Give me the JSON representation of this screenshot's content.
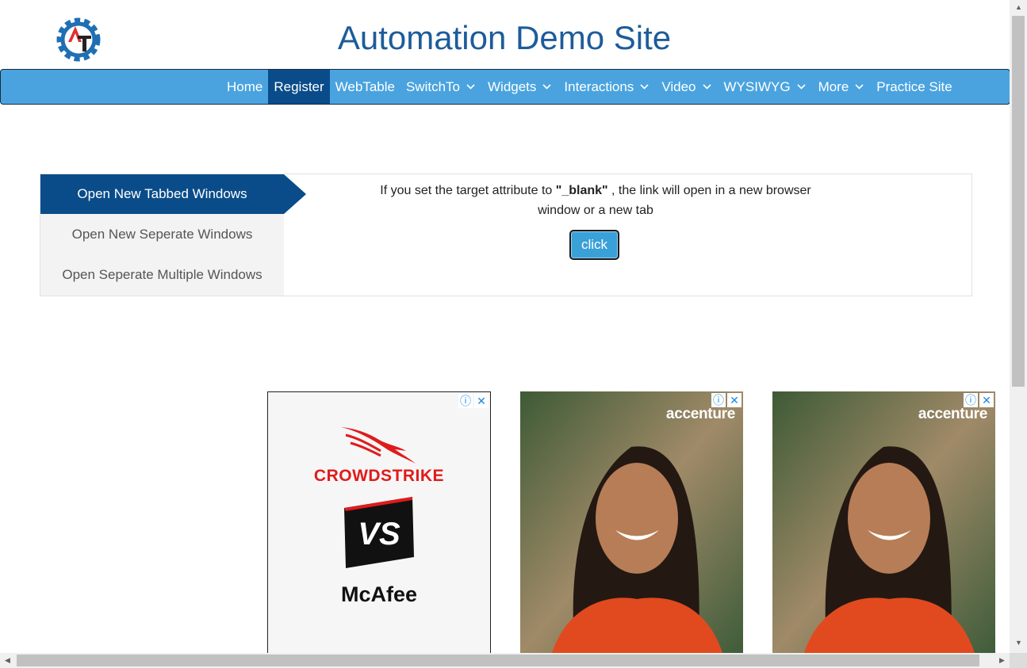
{
  "header": {
    "title": "Automation Demo Site",
    "logo_icon": "gear-logo-icon"
  },
  "nav": {
    "items": [
      {
        "label": "Home",
        "active": false,
        "dropdown": false
      },
      {
        "label": "Register",
        "active": true,
        "dropdown": false
      },
      {
        "label": "WebTable",
        "active": false,
        "dropdown": false
      },
      {
        "label": "SwitchTo",
        "active": false,
        "dropdown": true
      },
      {
        "label": "Widgets",
        "active": false,
        "dropdown": true
      },
      {
        "label": "Interactions",
        "active": false,
        "dropdown": true
      },
      {
        "label": "Video",
        "active": false,
        "dropdown": true
      },
      {
        "label": "WYSIWYG",
        "active": false,
        "dropdown": true
      },
      {
        "label": "More",
        "active": false,
        "dropdown": true
      },
      {
        "label": "Practice Site",
        "active": false,
        "dropdown": false
      }
    ]
  },
  "tabs": {
    "items": [
      {
        "label": "Open New Tabbed Windows"
      },
      {
        "label": "Open New Seperate Windows"
      },
      {
        "label": "Open Seperate Multiple Windows"
      }
    ],
    "content": {
      "text_before": "If you set the target attribute to ",
      "bold": "\"_blank\"",
      "text_after": " , the link will open in a new browser window or a new tab",
      "button_label": "click"
    }
  },
  "ads": {
    "ad1": {
      "brand1": "CROWDSTRIKE",
      "versus": "VS",
      "brand2": "McAfee"
    },
    "ad2": {
      "brand": "accenture"
    },
    "ad3": {
      "brand": "accenture"
    }
  },
  "colors": {
    "navbar": "#4aa3df",
    "active": "#0a4c8a",
    "title": "#1d5c9a",
    "button": "#3aa0d8"
  }
}
